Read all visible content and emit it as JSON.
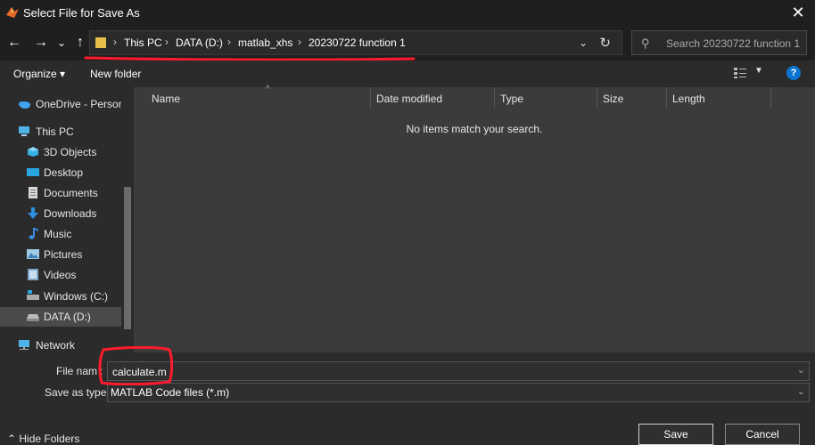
{
  "window": {
    "title": "Select File for Save As",
    "close_icon": "close-icon"
  },
  "nav_buttons": {
    "back": "←",
    "forward": "→",
    "recent": "⌄",
    "up": "↑"
  },
  "address": {
    "crumbs": [
      "This PC",
      "DATA (D:)",
      "matlab_xhs",
      "20230722 function 1"
    ],
    "dropdown": "⌄",
    "refresh": "↻"
  },
  "search": {
    "placeholder": "Search 20230722 function 1"
  },
  "toolbar": {
    "organize": "Organize ▾",
    "new_folder": "New folder",
    "help": "?"
  },
  "sidebar": {
    "items": [
      {
        "label": "OneDrive - Person",
        "icon": "onedrive-icon"
      },
      {
        "label": "This PC",
        "icon": "computer-icon"
      },
      {
        "label": "3D Objects",
        "icon": "cube-icon"
      },
      {
        "label": "Desktop",
        "icon": "desktop-icon"
      },
      {
        "label": "Documents",
        "icon": "document-icon"
      },
      {
        "label": "Downloads",
        "icon": "download-icon"
      },
      {
        "label": "Music",
        "icon": "music-icon"
      },
      {
        "label": "Pictures",
        "icon": "picture-icon"
      },
      {
        "label": "Videos",
        "icon": "video-icon"
      },
      {
        "label": "Windows (C:)",
        "icon": "drive-icon"
      },
      {
        "label": "DATA (D:)",
        "icon": "drive-icon"
      },
      {
        "label": "Network",
        "icon": "network-icon"
      }
    ]
  },
  "file_list": {
    "columns": [
      "Name",
      "Date modified",
      "Type",
      "Size",
      "Length"
    ],
    "empty_message": "No items match your search."
  },
  "form": {
    "file_name_label": "File nam",
    "file_name_value": "calculate.m",
    "save_type_label": "Save as type:",
    "save_type_value": "MATLAB Code files (*.m)"
  },
  "footer": {
    "hide_folders": "Hide Folders",
    "save": "Save",
    "cancel": "Cancel"
  },
  "colors": {
    "accent": "#0b74d1",
    "annotation": "#ff1a2e",
    "background": "#2b2b2b",
    "list_background": "#3b3b3b"
  }
}
